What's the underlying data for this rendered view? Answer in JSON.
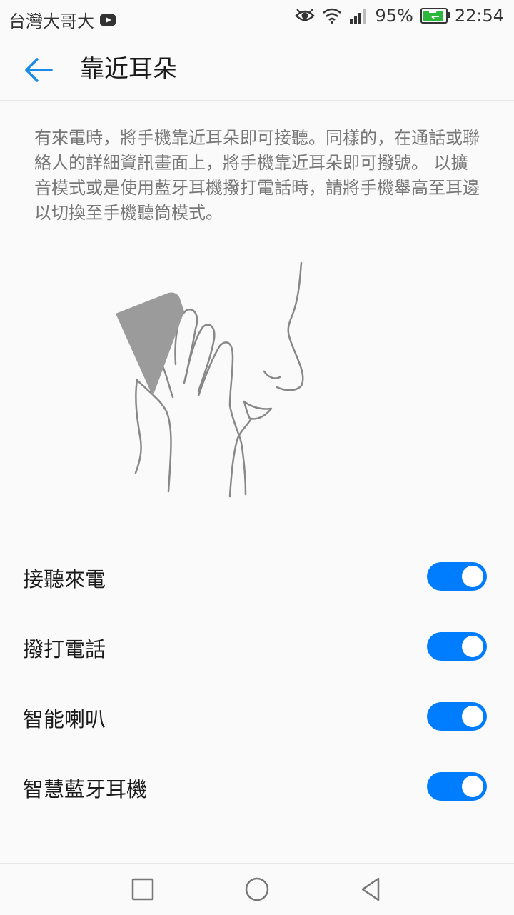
{
  "status_bar": {
    "carrier": "台灣大哥大",
    "battery": "95%",
    "time": "22:54",
    "icons": [
      "youtube-icon",
      "eye-icon",
      "wifi-icon",
      "signal-icon",
      "battery-charging-icon"
    ],
    "battery_level": 0.95
  },
  "header": {
    "title": "靠近耳朵",
    "back_icon": "back-arrow-icon"
  },
  "description": "有來電時，將手機靠近耳朵即可接聽。同樣的，在通話或聯絡人的詳細資訊畫面上，將手機靠近耳朵即可撥號。 以擴音模式或是使用藍牙耳機撥打電話時，請將手機舉高至耳邊以切換至手機聽筒模式。",
  "settings": [
    {
      "label": "接聽來電",
      "enabled": true
    },
    {
      "label": "撥打電話",
      "enabled": true
    },
    {
      "label": "智能喇叭",
      "enabled": true
    },
    {
      "label": "智慧藍牙耳機",
      "enabled": true
    }
  ],
  "colors": {
    "accent": "#007dff",
    "back_arrow": "#1a8ae6",
    "description_text": "#777777"
  },
  "nav_bar": {
    "icons": [
      "recents-square-icon",
      "home-circle-icon",
      "back-triangle-icon"
    ]
  }
}
